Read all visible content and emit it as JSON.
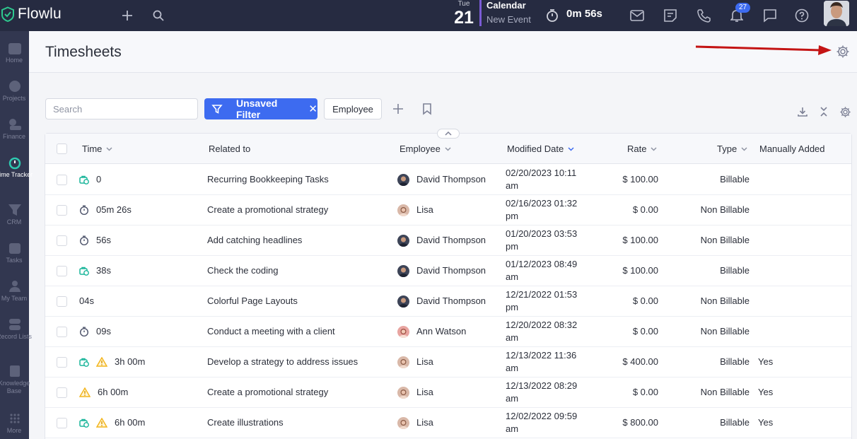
{
  "app": {
    "name": "Flowlu"
  },
  "topbar": {
    "calendar": {
      "day_of_week": "Tue",
      "day": "21",
      "title": "Calendar",
      "subtitle": "New Event"
    },
    "timer": "0m 56s",
    "notifications_count": "27"
  },
  "sidebar": {
    "items": [
      {
        "label": "Home",
        "icon": "home-icon"
      },
      {
        "label": "Projects",
        "icon": "projects-icon"
      },
      {
        "label": "Finance",
        "icon": "finance-icon"
      },
      {
        "label": "Time Tracker",
        "icon": "time-tracker-icon",
        "active": true
      },
      {
        "label": "CRM",
        "icon": "crm-icon"
      },
      {
        "label": "Tasks",
        "icon": "tasks-icon"
      },
      {
        "label": "My Team",
        "icon": "team-icon"
      },
      {
        "label": "Record Lists",
        "icon": "record-lists-icon"
      },
      {
        "label": "Knowledge Base",
        "icon": "knowledge-base-icon"
      },
      {
        "label": "More",
        "icon": "more-icon"
      }
    ]
  },
  "page": {
    "title": "Timesheets"
  },
  "toolbar": {
    "search_placeholder": "Search",
    "filter_label": "Unsaved Filter",
    "employee_label": "Employee"
  },
  "table": {
    "columns": {
      "time": "Time",
      "related": "Related to",
      "employee": "Employee",
      "modified": "Modified Date",
      "rate": "Rate",
      "type": "Type",
      "manual": "Manually Added"
    },
    "rows": [
      {
        "time": "0",
        "icons": [
          "billable"
        ],
        "related": "Recurring Bookkeeping Tasks",
        "employee": "David Thompson",
        "avatar": "male",
        "date": "02/20/2023 10:11 am",
        "rate": "$ 100.00",
        "type": "Billable",
        "manual": ""
      },
      {
        "time": "05m 26s",
        "icons": [
          "timer"
        ],
        "related": "Create a promotional strategy",
        "employee": "Lisa",
        "avatar": "female",
        "date": "02/16/2023 01:32 pm",
        "rate": "$ 0.00",
        "type": "Non Billable",
        "manual": ""
      },
      {
        "time": "56s",
        "icons": [
          "timer"
        ],
        "related": "Add catching headlines",
        "employee": "David Thompson",
        "avatar": "male",
        "date": "01/20/2023 03:53 pm",
        "rate": "$ 100.00",
        "type": "Non Billable",
        "manual": ""
      },
      {
        "time": "38s",
        "icons": [
          "billable"
        ],
        "related": "Check the coding",
        "employee": "David Thompson",
        "avatar": "male",
        "date": "01/12/2023 08:49 am",
        "rate": "$ 100.00",
        "type": "Billable",
        "manual": ""
      },
      {
        "time": "04s",
        "icons": [],
        "related": "Colorful Page Layouts",
        "employee": "David Thompson",
        "avatar": "male",
        "date": "12/21/2022 01:53 pm",
        "rate": "$ 0.00",
        "type": "Non Billable",
        "manual": ""
      },
      {
        "time": "09s",
        "icons": [
          "timer"
        ],
        "related": "Conduct a meeting with a client",
        "employee": "Ann Watson",
        "avatar": "female2",
        "date": "12/20/2022 08:32 am",
        "rate": "$ 0.00",
        "type": "Non Billable",
        "manual": ""
      },
      {
        "time": "3h 00m",
        "icons": [
          "billable",
          "warning"
        ],
        "related": "Develop a strategy to address issues",
        "employee": "Lisa",
        "avatar": "female",
        "date": "12/13/2022 11:36 am",
        "rate": "$ 400.00",
        "type": "Billable",
        "manual": "Yes"
      },
      {
        "time": "6h 00m",
        "icons": [
          "warning"
        ],
        "related": "Create a promotional strategy",
        "employee": "Lisa",
        "avatar": "female",
        "date": "12/13/2022 08:29 am",
        "rate": "$ 0.00",
        "type": "Non Billable",
        "manual": "Yes"
      },
      {
        "time": "6h 00m",
        "icons": [
          "billable",
          "warning"
        ],
        "related": "Create illustrations",
        "employee": "Lisa",
        "avatar": "female",
        "date": "12/02/2022 09:59 am",
        "rate": "$ 800.00",
        "type": "Billable",
        "manual": "Yes"
      }
    ]
  },
  "colors": {
    "topbar": "#262b41",
    "sidebar": "#323750",
    "accent": "#3d6bf0",
    "billable_icon": "#19b59a",
    "warning_icon": "#f3b61f",
    "annotation_arrow": "#c41414"
  }
}
